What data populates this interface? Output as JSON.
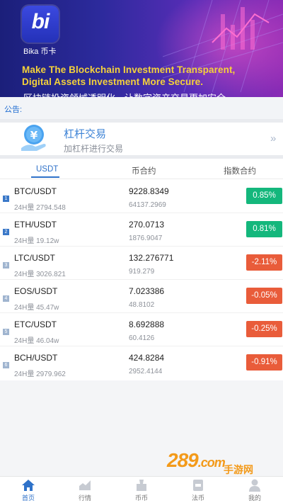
{
  "banner": {
    "logo_text": "bi",
    "app_name": "Bika 币卡",
    "slogan_line1": "Make The Blockchain Investment Transparent,",
    "slogan_line2": "Digital Assets Investment More Secure.",
    "slogan_cn": "区块链投资领域透明化，让数字资产交易更加安全"
  },
  "notice": {
    "label": "公告:"
  },
  "leverage": {
    "title": "杠杆交易",
    "subtitle": "加杠杆进行交易",
    "icon": "yen-coin-hand-icon",
    "arrow": "»"
  },
  "tabs": [
    {
      "label": "USDT",
      "active": true
    },
    {
      "label": "币合约",
      "active": false
    },
    {
      "label": "指数合约",
      "active": false
    }
  ],
  "market": [
    {
      "rank": "1",
      "pair": "BTC/USDT",
      "volume": "24H量 2794.548",
      "price": "9228.8349",
      "cny": "64137.2969",
      "change": "0.85%",
      "up": true
    },
    {
      "rank": "2",
      "pair": "ETH/USDT",
      "volume": "24H量 19.12w",
      "price": "270.0713",
      "cny": "1876.9047",
      "change": "0.81%",
      "up": true
    },
    {
      "rank": "3",
      "pair": "LTC/USDT",
      "volume": "24H量 3026.821",
      "price": "132.276771",
      "cny": "919.279",
      "change": "-2.11%",
      "up": false
    },
    {
      "rank": "4",
      "pair": "EOS/USDT",
      "volume": "24H量 45.47w",
      "price": "7.023386",
      "cny": "48.8102",
      "change": "-0.05%",
      "up": false
    },
    {
      "rank": "5",
      "pair": "ETC/USDT",
      "volume": "24H量 46.04w",
      "price": "8.692888",
      "cny": "60.4126",
      "change": "-0.25%",
      "up": false
    },
    {
      "rank": "6",
      "pair": "BCH/USDT",
      "volume": "24H量 2979.962",
      "price": "424.8284",
      "cny": "2952.4144",
      "change": "-0.91%",
      "up": false
    }
  ],
  "colors": {
    "up": "#14b77c",
    "down": "#e95c3a",
    "accent": "#2f72c9",
    "rank_top": "#3a78c8",
    "rank_rest": "#9fb4cf"
  },
  "watermark": {
    "text": "289",
    "suffix": ".com",
    "cn": "手游网"
  },
  "nav": [
    {
      "label": "首页",
      "icon": "home-icon",
      "active": true
    },
    {
      "label": "行情",
      "icon": "chart-icon",
      "active": false
    },
    {
      "label": "币币",
      "icon": "trade-icon",
      "active": false
    },
    {
      "label": "法币",
      "icon": "wallet-icon",
      "active": false
    },
    {
      "label": "我的",
      "icon": "user-icon",
      "active": false
    }
  ]
}
